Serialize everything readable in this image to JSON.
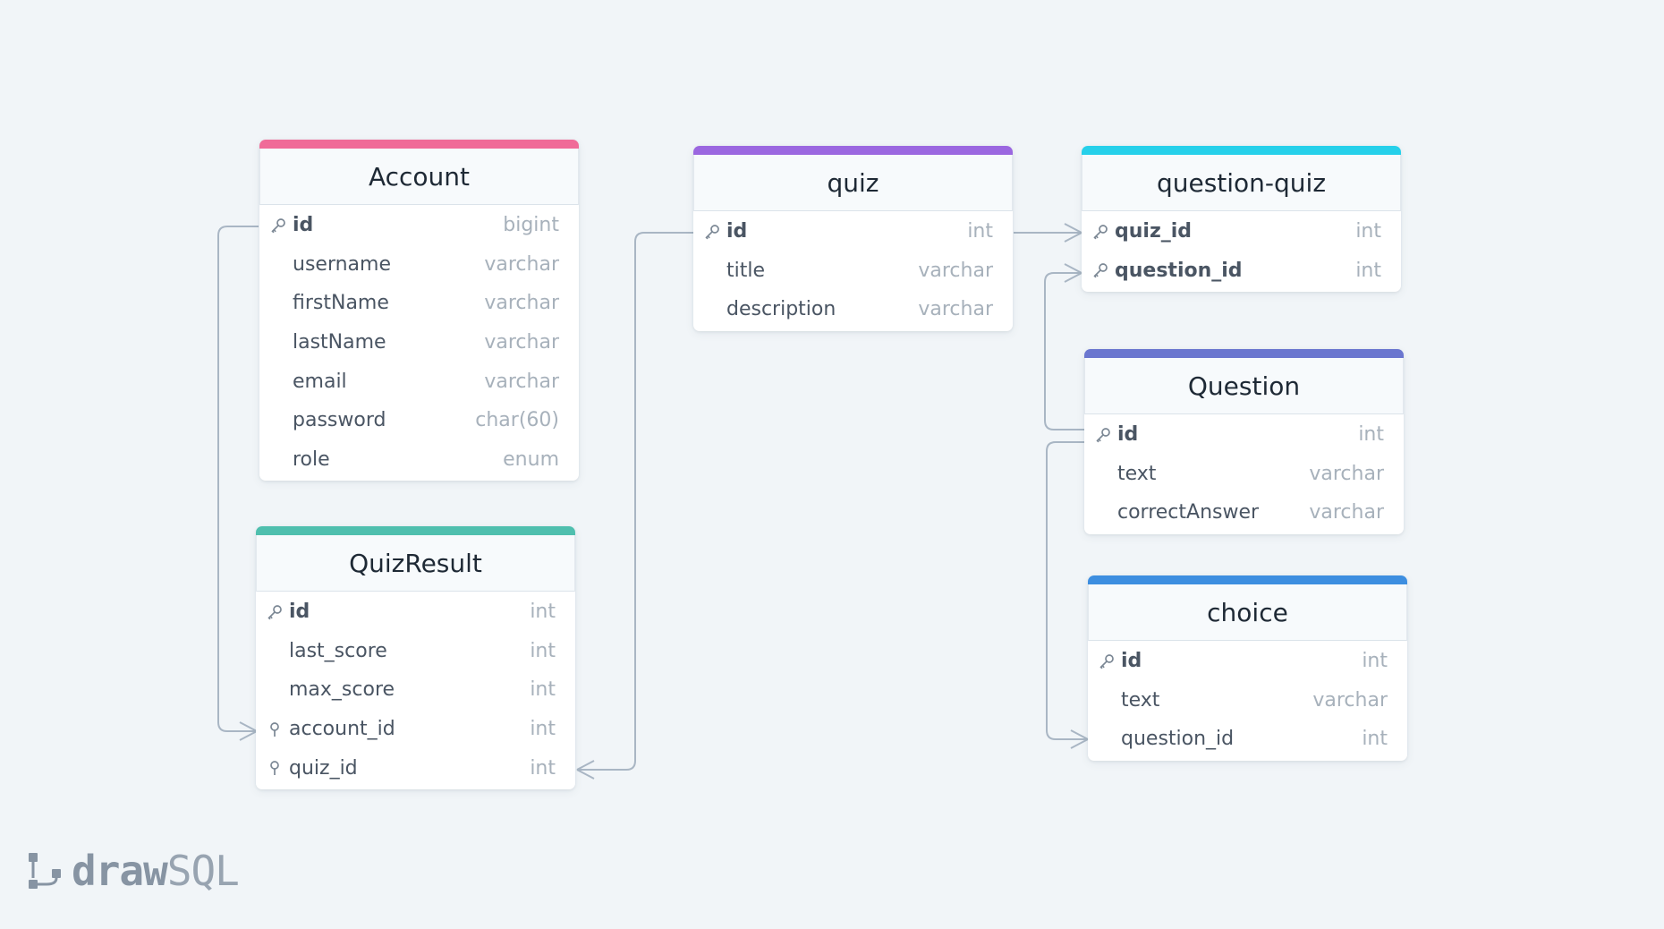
{
  "tables": [
    {
      "id": "account",
      "name": "Account",
      "color": "#f06b98",
      "fields": [
        {
          "name": "id",
          "type": "bigint",
          "pk": true
        },
        {
          "name": "username",
          "type": "varchar"
        },
        {
          "name": "firstName",
          "type": "varchar"
        },
        {
          "name": "lastName",
          "type": "varchar"
        },
        {
          "name": "email",
          "type": "varchar"
        },
        {
          "name": "password",
          "type": "char(60)"
        },
        {
          "name": "role",
          "type": "enum"
        }
      ]
    },
    {
      "id": "quizresult",
      "name": "QuizResult",
      "color": "#4fbfae",
      "fields": [
        {
          "name": "id",
          "type": "int",
          "pk": true
        },
        {
          "name": "last_score",
          "type": "int"
        },
        {
          "name": "max_score",
          "type": "int"
        },
        {
          "name": "account_id",
          "type": "int",
          "fk": true
        },
        {
          "name": "quiz_id",
          "type": "int",
          "fk": true
        }
      ]
    },
    {
      "id": "quiz",
      "name": "quiz",
      "color": "#9b67e0",
      "fields": [
        {
          "name": "id",
          "type": "int",
          "pk": true
        },
        {
          "name": "title",
          "type": "varchar"
        },
        {
          "name": "description",
          "type": "varchar"
        }
      ]
    },
    {
      "id": "questionquiz",
      "name": "question-quiz",
      "color": "#26d0ea",
      "fields": [
        {
          "name": "quiz_id",
          "type": "int",
          "pk": true
        },
        {
          "name": "question_id",
          "type": "int",
          "pk": true
        }
      ]
    },
    {
      "id": "question",
      "name": "Question",
      "color": "#6a76cf",
      "fields": [
        {
          "name": "id",
          "type": "int",
          "pk": true
        },
        {
          "name": "text",
          "type": "varchar"
        },
        {
          "name": "correctAnswer",
          "type": "varchar"
        }
      ]
    },
    {
      "id": "choice",
      "name": "choice",
      "color": "#3d8ee0",
      "fields": [
        {
          "name": "id",
          "type": "int",
          "pk": true
        },
        {
          "name": "text",
          "type": "varchar"
        },
        {
          "name": "question_id",
          "type": "int"
        }
      ]
    }
  ],
  "relations": [
    {
      "from": "account.id",
      "to": "quizresult.account_id"
    },
    {
      "from": "quiz.id",
      "to": "quizresult.quiz_id"
    },
    {
      "from": "quiz.id",
      "to": "questionquiz.quiz_id"
    },
    {
      "from": "question.id",
      "to": "questionquiz.question_id"
    },
    {
      "from": "question.id",
      "to": "choice.question_id"
    }
  ],
  "logo": {
    "bold": "draw",
    "light": "SQL",
    "icon": "drawsql-logo-icon"
  }
}
